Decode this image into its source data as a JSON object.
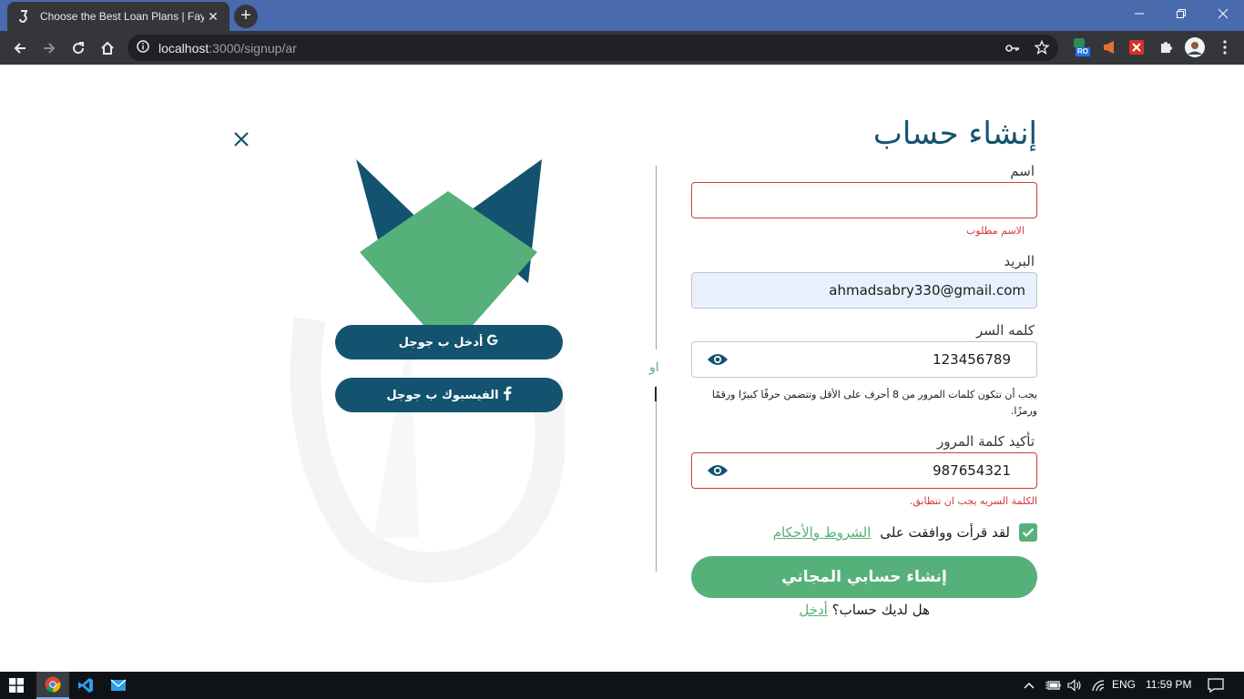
{
  "browser": {
    "tab_title": "Choose the Best Loan Plans | Fayed",
    "tab_close": "✕",
    "new_tab": "+",
    "url_host": "localhost",
    "url_path": ":3000/signup/ar",
    "extension_badge": "RO"
  },
  "page": {
    "social": {
      "google_label": "أدخل ب جوجل",
      "facebook_label": "الفيسبوك ب جوجل"
    },
    "or_label": "او",
    "form": {
      "title": "إنشاء حساب",
      "name_label": "اسم",
      "name_value": "",
      "name_error": "الاسم مطلوب",
      "email_label": "البريد",
      "email_value": "ahmadsabry330@gmail.com",
      "password_label": "كلمه السر",
      "password_value": "123456789",
      "password_hint": "يجب أن تتكون كلمات المرور من 8 أحرف على الأقل وتتضمن حرفًا كبيرًا ورقمًا ورمزًا.",
      "confirm_label": "تأكيد كلمة المرور",
      "confirm_value": "987654321",
      "confirm_error": "الكلمة السريه يجب ان تتطابق.",
      "terms_prefix": "لقد قرأت ووافقت على",
      "terms_link": "الشروط والأحكام",
      "submit_label": "إنشاء حسابي المجاني",
      "have_account": "هل لديك حساب؟",
      "login_link": "أدخل"
    }
  },
  "taskbar": {
    "language": "ENG",
    "time": "11:59 PM"
  },
  "colors": {
    "brand_dark": "#13536f",
    "brand_green": "#56b07a",
    "error": "#d3383a",
    "titlebar": "#4a6aae"
  }
}
